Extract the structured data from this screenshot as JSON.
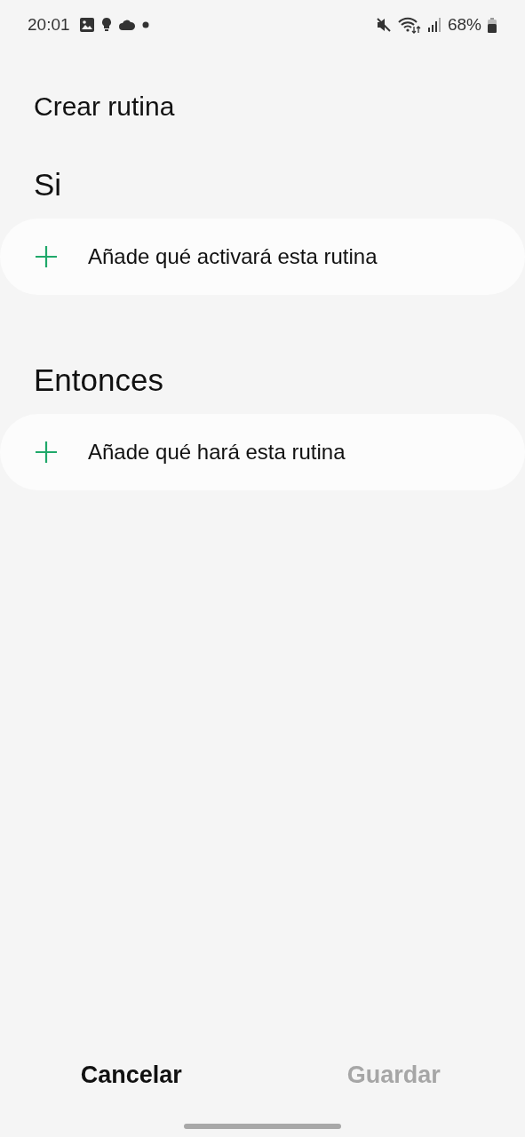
{
  "status_bar": {
    "time": "20:01",
    "battery": "68%"
  },
  "title": "Crear rutina",
  "sections": [
    {
      "heading": "Si",
      "action": "Añade qué activará esta rutina"
    },
    {
      "heading": "Entonces",
      "action": "Añade qué hará esta rutina"
    }
  ],
  "buttons": [
    {
      "label": "Cancelar",
      "disabled": false
    },
    {
      "label": "Guardar",
      "disabled": true
    }
  ]
}
